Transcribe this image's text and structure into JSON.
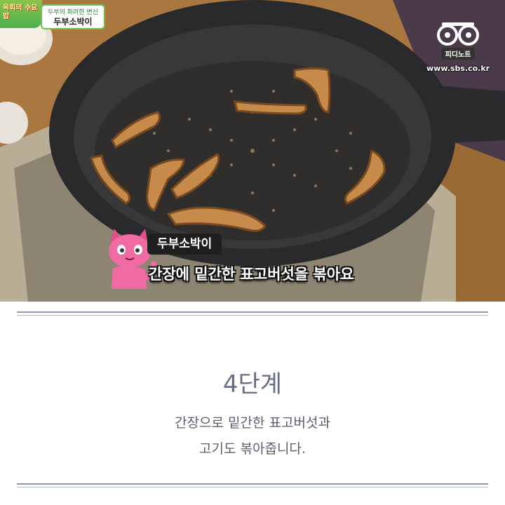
{
  "photo": {
    "show_logo_text": "옥희의 수요밥",
    "episode_subtitle": "두부의 화려한 변신",
    "episode_title": "두부소박이",
    "watermark_brand": "피디노트",
    "watermark_url": "www.sbs.co.kr",
    "caption_tag": "두부소박이",
    "caption_main": "간장에 밑간한 표고버섯을 볶아요"
  },
  "step": {
    "title": "4단계",
    "description_line1": "간장으로 밑간한 표고버섯과",
    "description_line2": "고기도 볶아줍니다."
  },
  "colors": {
    "divider": "#8f96b2",
    "title_text": "#6a6e84",
    "body_text": "#5b5e6e",
    "caption_tag_bg": "#1f1f1f"
  },
  "icons": [
    "cat-mascot-icon",
    "pd-note-eyes-icon"
  ]
}
